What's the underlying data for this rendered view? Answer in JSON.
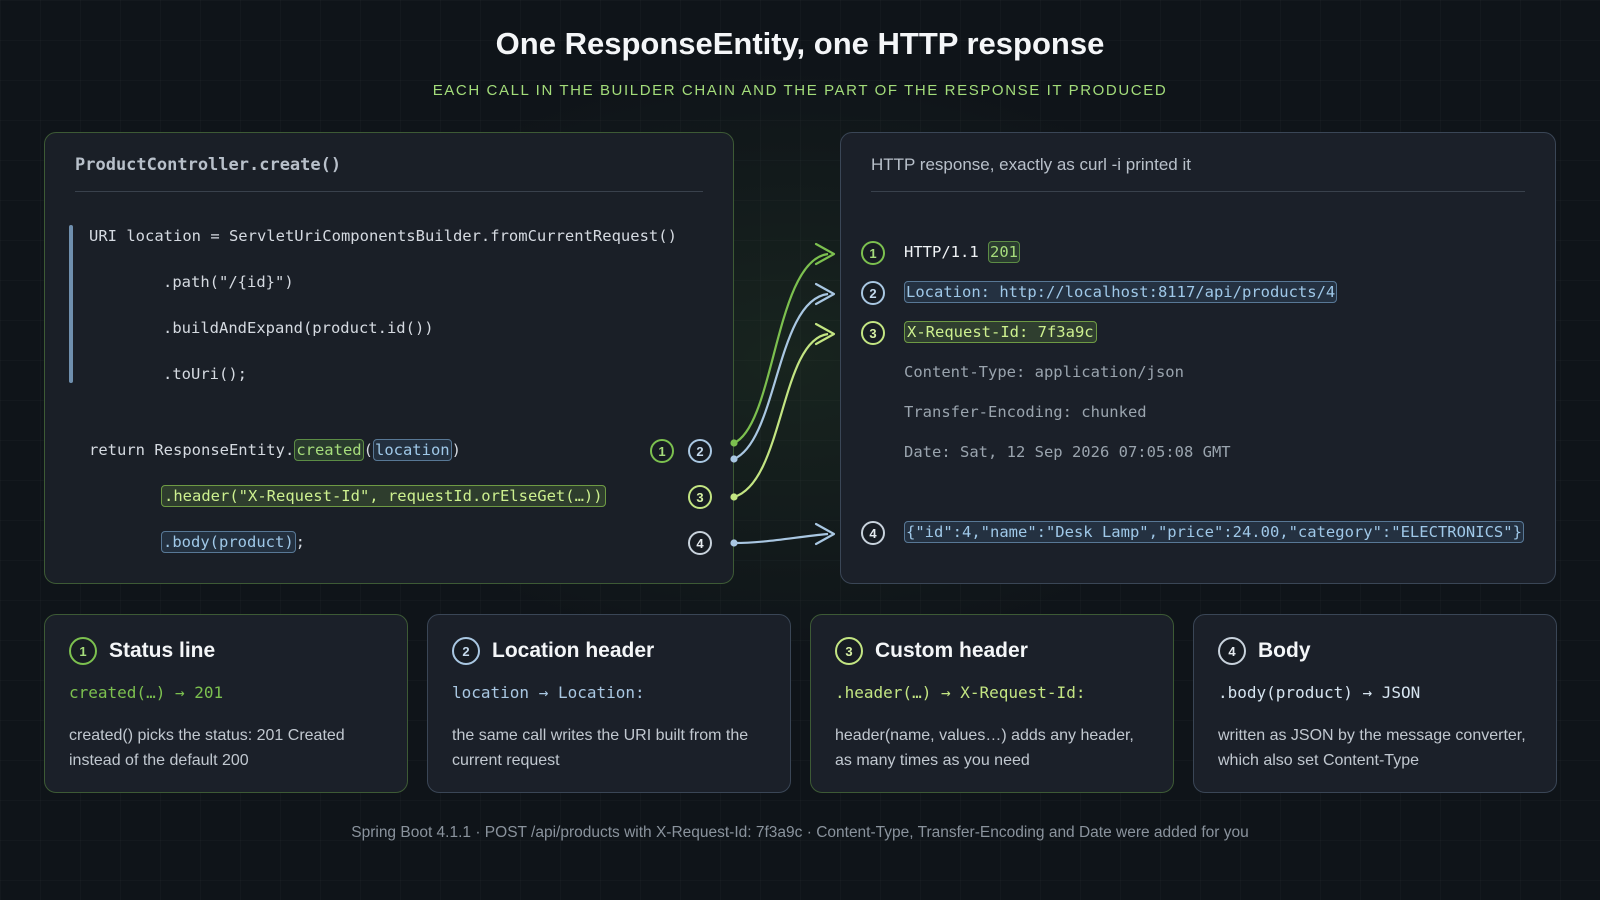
{
  "title": "One ResponseEntity, one HTTP response",
  "subtitle": "EACH CALL IN THE BUILDER CHAIN AND THE PART OF THE RESPONSE IT PRODUCED",
  "code_panel": {
    "title": "ProductController.create()",
    "lines": [
      "URI location = ServletUriComponentsBuilder.fromCurrentRequest()",
      ".path(\"/{id}\")",
      ".buildAndExpand(product.id())",
      ".toUri();"
    ],
    "return_prefix": "return ResponseEntity.",
    "created_call": "created",
    "open_paren": "(",
    "location_arg": "location",
    "close_paren": ")",
    "header_call": ".header(\"X-Request-Id\", requestId.orElseGet(…))",
    "body_call": ".body(product)",
    "semicolon": ";"
  },
  "http_panel": {
    "title": "HTTP response, exactly as curl -i printed it",
    "status_prefix": "HTTP/1.1 ",
    "status_code": "201",
    "location_header": "Location: http://localhost:8117/api/products/4",
    "request_id_header": "X-Request-Id: 7f3a9c",
    "content_type": "Content-Type: application/json",
    "transfer_encoding": "Transfer-Encoding: chunked",
    "date": "Date: Sat, 12 Sep 2026 07:05:08 GMT",
    "body": "{\"id\":4,\"name\":\"Desk Lamp\",\"price\":24.00,\"category\":\"ELECTRONICS\"}"
  },
  "markers": [
    "1",
    "2",
    "3",
    "4"
  ],
  "cards": [
    {
      "num": "1",
      "title": "Status line",
      "code": "created(…) → 201",
      "desc": "created() picks the status: 201 Created instead of the default 200"
    },
    {
      "num": "2",
      "title": "Location header",
      "code": "location → Location:",
      "desc": "the same call writes the URI built from the current request"
    },
    {
      "num": "3",
      "title": "Custom header",
      "code": ".header(…) → X-Request-Id:",
      "desc": "header(name, values…) adds any header, as many times as you need"
    },
    {
      "num": "4",
      "title": "Body",
      "code": ".body(product) → JSON",
      "desc": "written as JSON by the message converter, which also set Content-Type"
    }
  ],
  "colors": {
    "green": "#7cc04f",
    "blue": "#a9c7e2",
    "light_green": "#c3e582",
    "subtitle": "#a3dc7a",
    "background": "#0f1419"
  },
  "footer": "Spring Boot 4.1.1 · POST /api/products with X-Request-Id: 7f3a9c · Content-Type, Transfer-Encoding and Date were added for you"
}
